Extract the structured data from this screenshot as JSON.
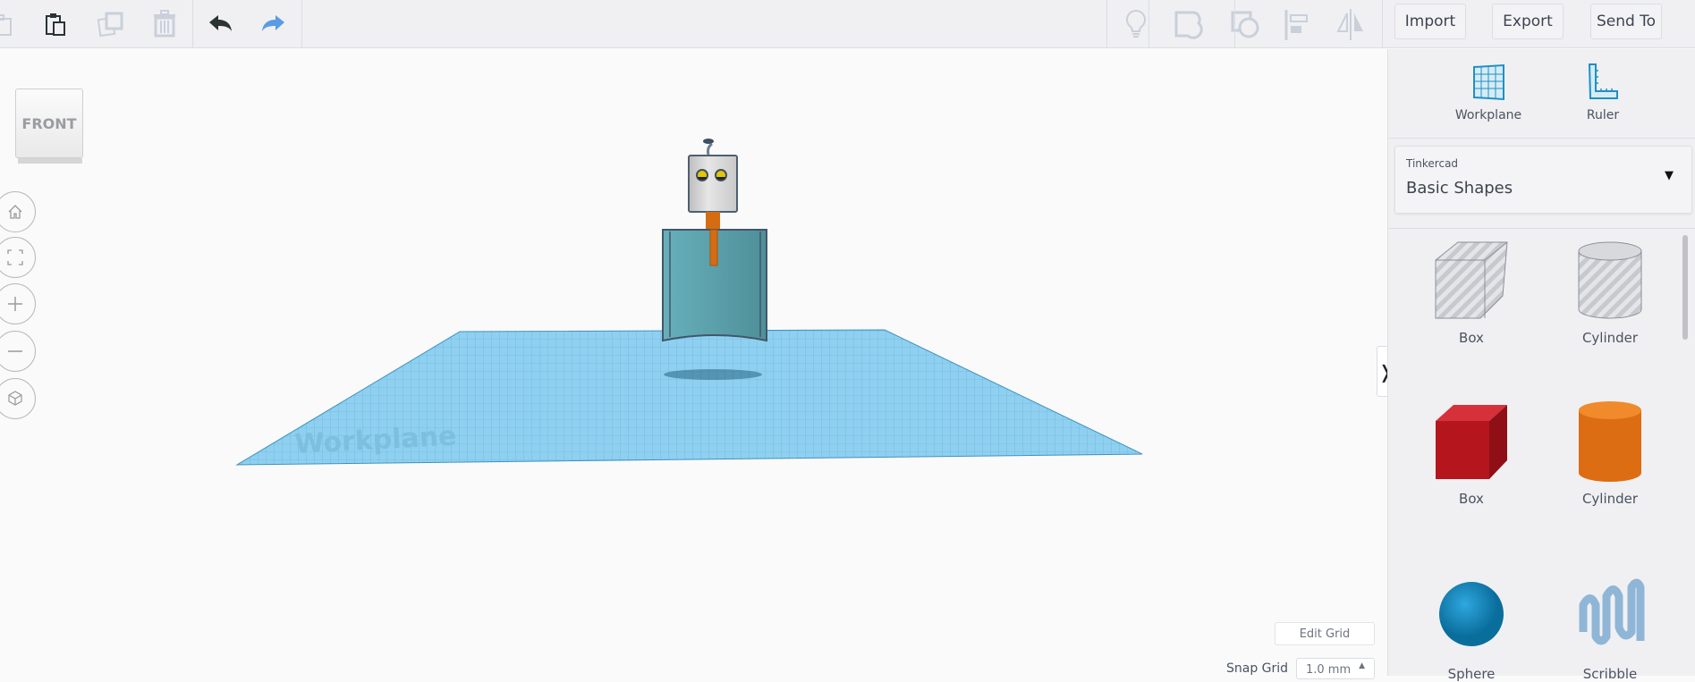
{
  "toolbar": {
    "import": "Import",
    "export": "Export",
    "send_to": "Send To"
  },
  "panel": {
    "workplane": "Workplane",
    "ruler": "Ruler",
    "library_source": "Tinkercad",
    "library_name": "Basic Shapes",
    "shapes": [
      {
        "label": "Box"
      },
      {
        "label": "Cylinder"
      },
      {
        "label": "Box"
      },
      {
        "label": "Cylinder"
      },
      {
        "label": "Sphere"
      },
      {
        "label": "Scribble"
      }
    ]
  },
  "viewcube": {
    "face": "FRONT"
  },
  "workplane_label": "Workplane",
  "grid": {
    "edit_label": "Edit Grid",
    "snap_label": "Snap Grid",
    "snap_value": "1.0 mm"
  }
}
